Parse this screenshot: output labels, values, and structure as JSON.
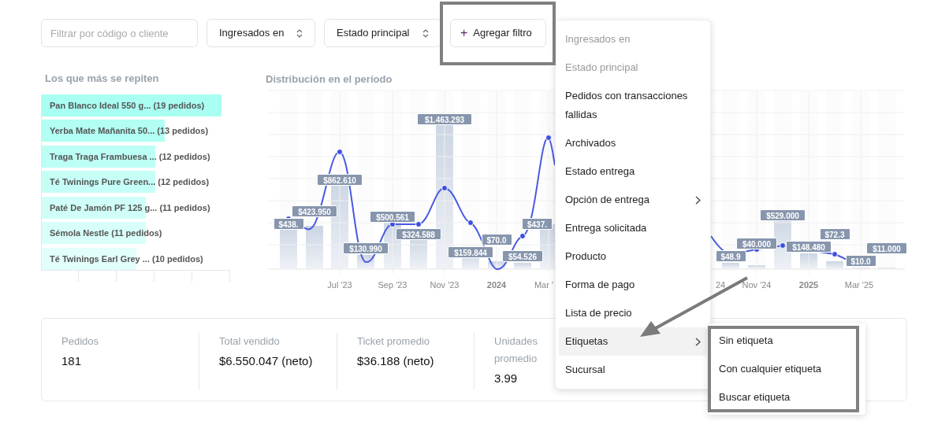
{
  "filters": {
    "search": {
      "placeholder": "Filtrar por código o cliente"
    },
    "selects": [
      {
        "label": "Ingresados en"
      },
      {
        "label": "Estado principal"
      }
    ],
    "add_button": {
      "icon": "+",
      "label": "Agregar filtro"
    }
  },
  "top_products": {
    "title": "Los que más se repiten",
    "rows": [
      {
        "label": "Pan Blanco Ideal 550 g... (19 pedidos)",
        "level": 0.95
      },
      {
        "label": "Yerba Mate Mañanita 50... (13 pedidos)",
        "level": 0.65
      },
      {
        "label": "Traga Traga Frambuesa ... (12 pedidos)",
        "level": 0.6
      },
      {
        "label": "Té Twinings Pure Green... (12 pedidos)",
        "level": 0.6
      },
      {
        "label": "Paté De Jamón PF 125 g... (11 pedidos)",
        "level": 0.55
      },
      {
        "label": "Sémola Nestle (11 pedidos)",
        "level": 0.55
      },
      {
        "label": "Té Twinings Earl Grey ... (10 pedidos)",
        "level": 0.5
      }
    ]
  },
  "distribution": {
    "title": "Distribución en el período",
    "bars": [
      {
        "label": "$438.",
        "level": 0.25
      },
      {
        "label": "$423.950",
        "level": 0.24
      },
      {
        "label": "$862.610",
        "level": 0.5
      },
      {
        "label": "$130.990",
        "level": 0.075
      },
      {
        "label": "$500.561",
        "level": 0.29
      },
      {
        "label": "$324.588",
        "level": 0.19
      },
      {
        "label": "$1.463.293",
        "level": 0.84
      },
      {
        "label": "$159.844",
        "level": 0.09
      },
      {
        "label": "$70.0",
        "level": 0.04
      },
      {
        "label": "$54.526",
        "level": 0.03
      },
      {
        "label": "$437.",
        "level": 0.25
      },
      {
        "label": "$48.9",
        "level": 0.03
      },
      {
        "label": "$40.000",
        "level": 0.02
      },
      {
        "label": "$529.000",
        "level": 0.3
      },
      {
        "label": "$148.480",
        "level": 0.085
      },
      {
        "label": "$72.3",
        "level": 0.04
      },
      {
        "label": "$10.0",
        "level": 0.006
      },
      {
        "label": "$11.000",
        "level": 0.006
      }
    ],
    "xticks": [
      {
        "label": "Jul '23",
        "bold": false
      },
      {
        "label": "Sep '23",
        "bold": false
      },
      {
        "label": "Nov '23",
        "bold": false
      },
      {
        "label": "2024",
        "bold": true
      },
      {
        "label": "Mar '",
        "bold": false
      },
      {
        "label": "24",
        "bold": false
      },
      {
        "label": "Nov '24",
        "bold": false
      },
      {
        "label": "2025",
        "bold": true
      },
      {
        "label": "Mar '25",
        "bold": false
      }
    ]
  },
  "stats": [
    {
      "label": "Pedidos",
      "value": "181"
    },
    {
      "label": "Total vendido",
      "value": "$6.550.047 (neto)"
    },
    {
      "label": "Ticket promedio",
      "value": "$36.188 (neto)"
    },
    {
      "label": "Unidades promedio",
      "value": "3.99"
    }
  ],
  "filter_menu": {
    "items": [
      {
        "label": "Ingresados en",
        "disabled": true,
        "submenu": false,
        "selected": false
      },
      {
        "label": "Estado principal",
        "disabled": true,
        "submenu": false,
        "selected": false
      },
      {
        "label": "Pedidos con transacciones fallidas",
        "disabled": false,
        "submenu": false,
        "selected": false
      },
      {
        "label": "Archivados",
        "disabled": false,
        "submenu": false,
        "selected": false
      },
      {
        "label": "Estado entrega",
        "disabled": false,
        "submenu": false,
        "selected": false
      },
      {
        "label": "Opción de entrega",
        "disabled": false,
        "submenu": true,
        "selected": false
      },
      {
        "label": "Entrega solicitada",
        "disabled": false,
        "submenu": false,
        "selected": false
      },
      {
        "label": "Producto",
        "disabled": false,
        "submenu": false,
        "selected": false
      },
      {
        "label": "Forma de pago",
        "disabled": false,
        "submenu": false,
        "selected": false
      },
      {
        "label": "Lista de precio",
        "disabled": false,
        "submenu": false,
        "selected": false
      },
      {
        "label": "Etiquetas",
        "disabled": false,
        "submenu": true,
        "selected": true
      },
      {
        "label": "Sucursal",
        "disabled": false,
        "submenu": false,
        "selected": false
      }
    ]
  },
  "submenu": {
    "items": [
      {
        "label": "Sin etiqueta"
      },
      {
        "label": "Con cualquier etiqueta"
      },
      {
        "label": "Buscar etiqueta"
      }
    ]
  }
}
